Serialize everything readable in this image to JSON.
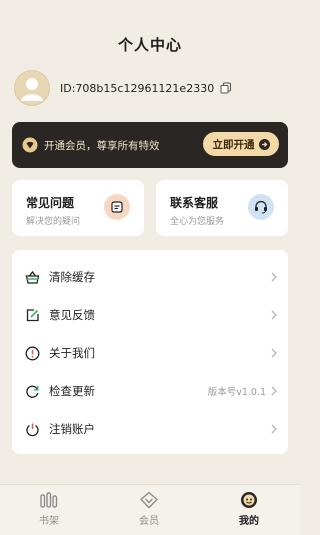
{
  "header": {
    "title": "个人中心"
  },
  "profile": {
    "id_text": "ID:708b15c12961121e2330"
  },
  "vip": {
    "promo_text": "开通会员，尊享所有特效",
    "button_label": "立即开通"
  },
  "cards": [
    {
      "title": "常见问题",
      "subtitle": "解决您的疑问",
      "icon": "document-icon",
      "icon_bg": "#f6d7c2"
    },
    {
      "title": "联系客服",
      "subtitle": "全心为您服务",
      "icon": "headset-icon",
      "icon_bg": "#cfe3f5"
    }
  ],
  "menu": {
    "items": [
      {
        "label": "清除缓存",
        "icon": "basket-icon"
      },
      {
        "label": "意见反馈",
        "icon": "edit-icon"
      },
      {
        "label": "关于我们",
        "icon": "info-icon"
      },
      {
        "label": "检查更新",
        "icon": "refresh-icon",
        "value": "版本号v1.0.1"
      },
      {
        "label": "注销账户",
        "icon": "power-icon"
      }
    ]
  },
  "tabbar": {
    "tabs": [
      {
        "label": "书架",
        "icon": "bookshelf-icon"
      },
      {
        "label": "会员",
        "icon": "vip-icon"
      },
      {
        "label": "我的",
        "icon": "profile-icon",
        "active": true
      }
    ]
  },
  "colors": {
    "background": "#f2ede4",
    "banner": "#2a2623",
    "accent_gold": "#f3d9a6",
    "text_primary": "#222222"
  }
}
